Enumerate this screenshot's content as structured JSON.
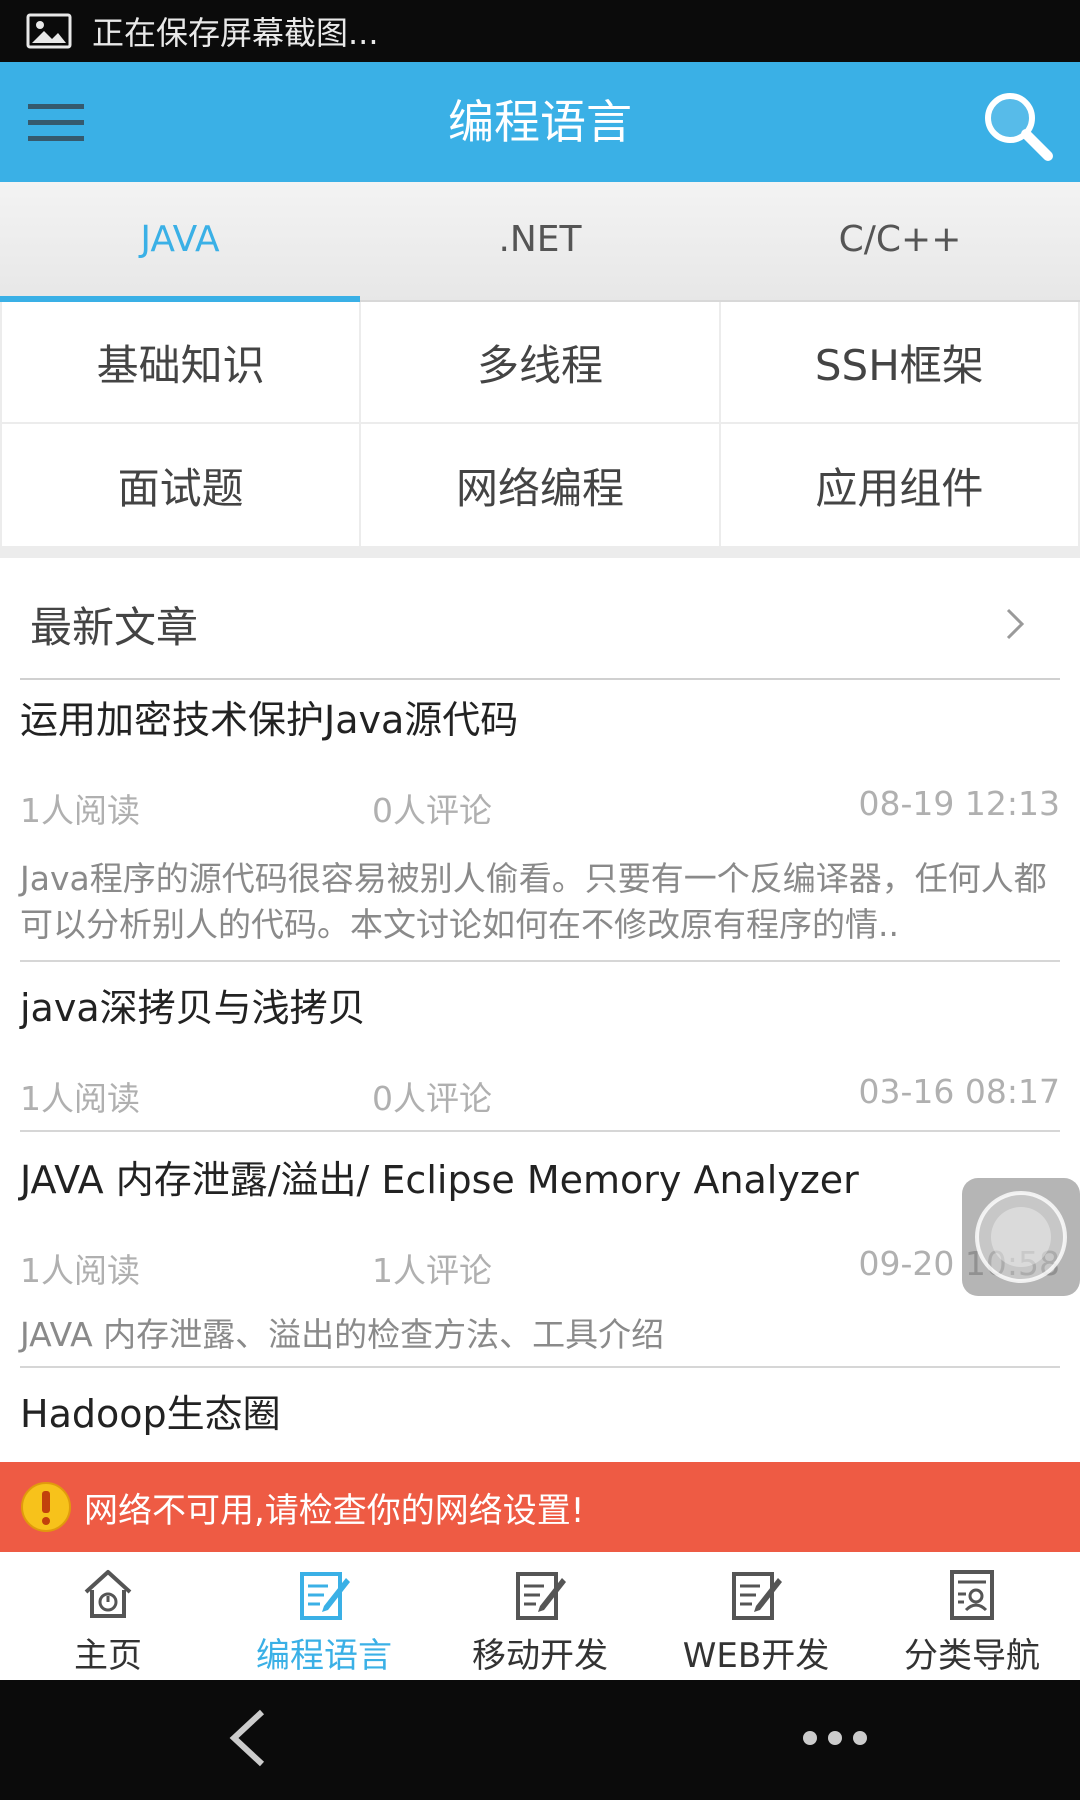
{
  "status_bar": {
    "text": "正在保存屏幕截图..."
  },
  "app_bar": {
    "title": "编程语言"
  },
  "lang_tabs": [
    {
      "label": "JAVA",
      "active": true
    },
    {
      "label": ".NET",
      "active": false
    },
    {
      "label": "C/C++",
      "active": false
    }
  ],
  "categories": [
    "基础知识",
    "多线程",
    "SSH框架",
    "面试题",
    "网络编程",
    "应用组件"
  ],
  "latest": {
    "label": "最新文章"
  },
  "articles": [
    {
      "title": "运用加密技术保护Java源代码",
      "reads": "1人阅读",
      "comments": "0人评论",
      "date": "08-19 12:13",
      "summary": "Java程序的源代码很容易被别人偷看。只要有一个反编译器，任何人都可以分析别人的代码。本文讨论如何在不修改原有程序的情.."
    },
    {
      "title": "java深拷贝与浅拷贝",
      "reads": "1人阅读",
      "comments": "0人评论",
      "date": "03-16 08:17",
      "summary": ""
    },
    {
      "title": "JAVA  内存泄露/溢出/ Eclipse Memory Analyzer",
      "reads": "1人阅读",
      "comments": "1人评论",
      "date": "09-20 10:58",
      "summary": "JAVA  内存泄露、溢出的检查方法、工具介绍"
    },
    {
      "title": "Hadoop生态圈"
    }
  ],
  "network_banner": {
    "text": "网络不可用,请检查你的网络设置!"
  },
  "bottom_nav": [
    {
      "label": "主页",
      "icon": "home-icon",
      "active": false
    },
    {
      "label": "编程语言",
      "icon": "edit-doc-icon",
      "active": true
    },
    {
      "label": "移动开发",
      "icon": "edit-doc-icon",
      "active": false
    },
    {
      "label": "WEB开发",
      "icon": "edit-doc-icon",
      "active": false
    },
    {
      "label": "分类导航",
      "icon": "directory-icon",
      "active": false
    }
  ],
  "colors": {
    "accent": "#3ab0e6",
    "banner": "#ee5b44",
    "bar": "#0b0b0b"
  }
}
